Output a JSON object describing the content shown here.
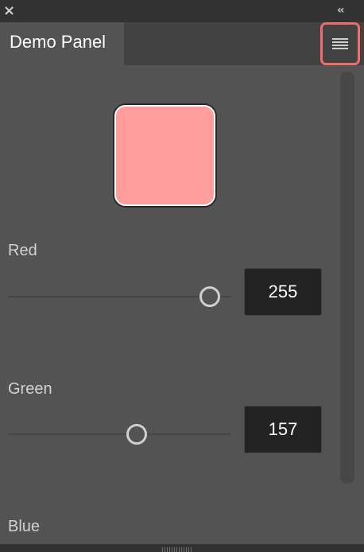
{
  "window": {
    "close_icon": "close-icon",
    "collapse_icon": "collapse-double-chevron-icon",
    "collapse_glyph": "‹‹"
  },
  "tab": {
    "title": "Demo Panel"
  },
  "menu": {
    "icon": "hamburger-menu-icon"
  },
  "swatch": {
    "color": "#ff9d9d"
  },
  "sliders": {
    "red": {
      "label": "Red",
      "value": "255",
      "min": 0,
      "max": 255
    },
    "green": {
      "label": "Green",
      "value": "157",
      "min": 0,
      "max": 255
    },
    "blue": {
      "label": "Blue"
    }
  },
  "colors": {
    "panel_bg": "#535353",
    "highlight": "#f26b6b"
  }
}
